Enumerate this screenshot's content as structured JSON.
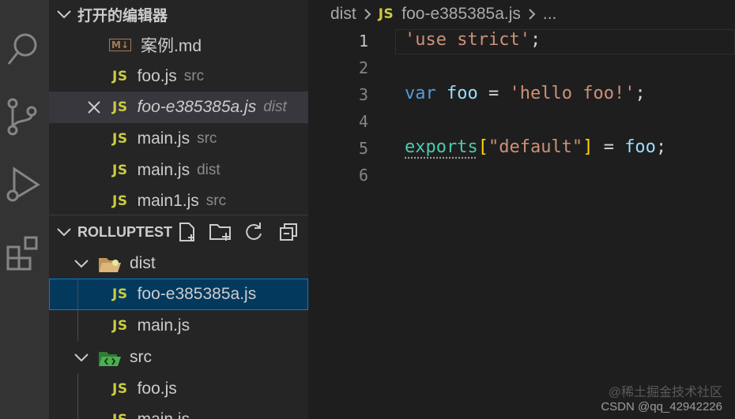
{
  "open_editors": {
    "title": "打开的编辑器",
    "items": [
      {
        "name": "案例.md",
        "dir": "",
        "type": "md"
      },
      {
        "name": "foo.js",
        "dir": "src",
        "type": "js"
      },
      {
        "name": "foo-e385385a.js",
        "dir": "dist",
        "type": "js"
      },
      {
        "name": "main.js",
        "dir": "src",
        "type": "js"
      },
      {
        "name": "main.js",
        "dir": "dist",
        "type": "js"
      },
      {
        "name": "main1.js",
        "dir": "src",
        "type": "js"
      }
    ]
  },
  "explorer": {
    "title": "ROLLUPTEST",
    "tree": [
      {
        "name": "dist"
      },
      {
        "name": "foo-e385385a.js"
      },
      {
        "name": "main.js"
      },
      {
        "name": "src"
      },
      {
        "name": "foo.js"
      },
      {
        "name": "main.js"
      }
    ]
  },
  "js_badge": "JS",
  "md_badge": "M↓",
  "breadcrumb": {
    "folder": "dist",
    "file": "foo-e385385a.js",
    "more": "..."
  },
  "editor": {
    "line_numbers": [
      "1",
      "2",
      "3",
      "4",
      "5",
      "6"
    ],
    "code": {
      "l1_str": "'use strict'",
      "l1_semi": ";",
      "l3_kw": "var",
      "l3_var": "foo",
      "l3_eq": "=",
      "l3_str": "'hello foo!'",
      "l3_semi": ";",
      "l5_obj": "exports",
      "l5_lb": "[",
      "l5_key": "\"default\"",
      "l5_rb": "]",
      "l5_eq": "=",
      "l5_var": "foo",
      "l5_semi": ";"
    }
  },
  "watermark": {
    "line1": "@稀土掘金技术社区",
    "line2": "CSDN @qq_42942226"
  },
  "colors": {
    "accent": "#007fd4",
    "js": "#cbcb41",
    "selected": "#04395e"
  }
}
